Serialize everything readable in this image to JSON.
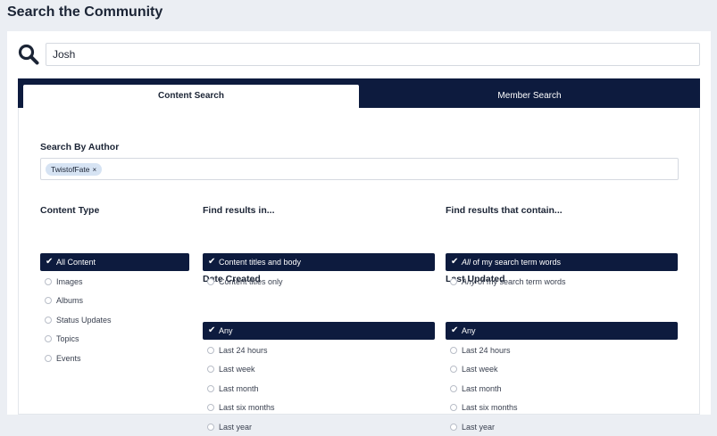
{
  "page": {
    "title": "Search the Community"
  },
  "search": {
    "value": "Josh"
  },
  "tabs": [
    {
      "label": "Content Search",
      "active": true
    },
    {
      "label": "Member Search",
      "active": false
    }
  ],
  "author": {
    "label": "Search By Author",
    "tags": [
      "TwistofFate"
    ],
    "remove_glyph": "×"
  },
  "content_type": {
    "label": "Content Type",
    "options": [
      "All Content",
      "Images",
      "Albums",
      "Status Updates",
      "Topics",
      "Events"
    ],
    "selected": 0
  },
  "find_in": {
    "label": "Find results in...",
    "options": [
      "Content titles and body",
      "Content titles only"
    ],
    "selected": 0
  },
  "contain": {
    "label": "Find results that contain...",
    "options": [
      {
        "em": "All",
        "rest": " of my search term words"
      },
      {
        "em": "Any",
        "rest": " of my search term words"
      }
    ],
    "selected": 0
  },
  "date_created": {
    "label": "Date Created",
    "options": [
      "Any",
      "Last 24 hours",
      "Last week",
      "Last month",
      "Last six months",
      "Last year"
    ],
    "selected": 0
  },
  "last_updated": {
    "label": "Last Updated",
    "options": [
      "Any",
      "Last 24 hours",
      "Last week",
      "Last month",
      "Last six months",
      "Last year"
    ],
    "selected": 0
  },
  "colors": {
    "navy": "#0d1b3e",
    "tag_bg": "#d6e3f3",
    "page_bg": "#ebeef3"
  },
  "icons": {
    "search": "magnifier-icon",
    "check": "checkmark-icon"
  }
}
